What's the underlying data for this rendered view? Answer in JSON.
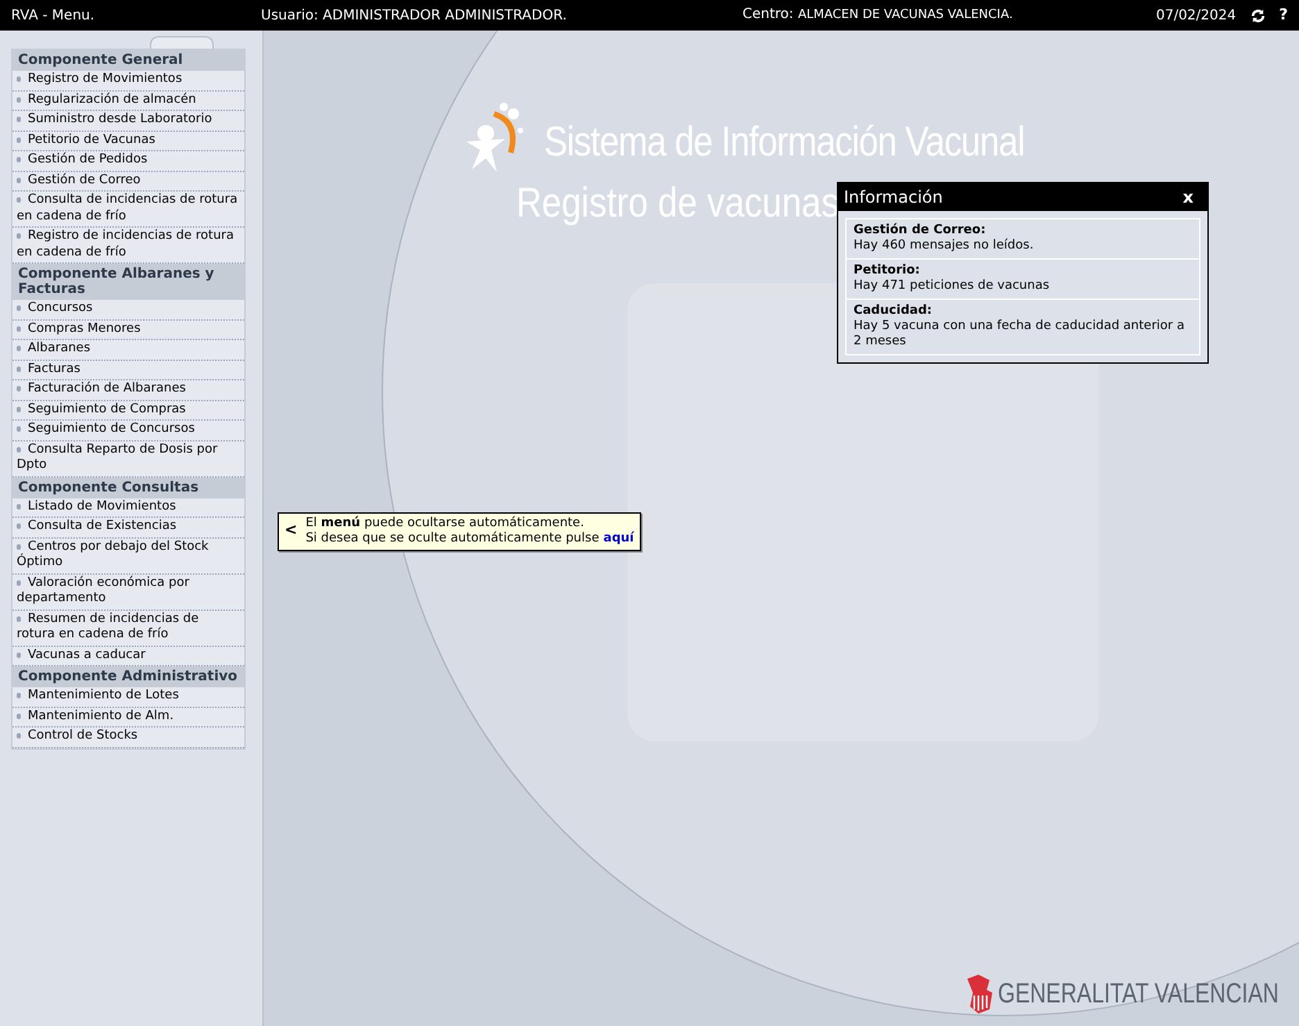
{
  "top_bar": {
    "app": "RVA - Menu.",
    "user_label": "Usuario:",
    "user": "ADMINISTRADOR ADMINISTRADOR.",
    "center_label": "Centro:",
    "center": "ALMACEN DE VACUNAS VALENCIA.",
    "date": "07/02/2024",
    "help": "?"
  },
  "menu": [
    {
      "title": "Componente General",
      "items": [
        "Registro de Movimientos",
        "Regularización de almacén",
        "Suministro desde Laboratorio",
        "Petitorio de Vacunas",
        "Gestión de Pedidos",
        "Gestión de Correo",
        "Consulta de incidencias de rotura en cadena de frío",
        "Registro de incidencias de rotura en cadena de frío"
      ]
    },
    {
      "title": "Componente Albaranes y Facturas",
      "items": [
        "Concursos",
        "Compras Menores",
        "Albaranes",
        "Facturas",
        "Facturación de Albaranes",
        "Seguimiento de Compras",
        "Seguimiento de Concursos",
        "Consulta Reparto de Dosis por Dpto"
      ]
    },
    {
      "title": "Componente Consultas",
      "items": [
        "Listado de Movimientos",
        "Consulta de Existencias",
        "Centros por debajo del Stock Óptimo",
        "Valoración económica por departamento",
        "Resumen de incidencias de rotura en cadena de frío",
        "Vacunas a caducar"
      ]
    },
    {
      "title": "Componente Administrativo",
      "items": [
        "Mantenimiento de Lotes",
        "Mantenimiento de Alm.",
        "Control de Stocks"
      ]
    }
  ],
  "tooltip": {
    "arrow": "<",
    "line_1": "El **menú** puede ocultarse automáticamente.",
    "line_2": "Si desea que se oculte automáticamente pulse",
    "link": "aquí"
  },
  "banner": {
    "title": "Sistema de Información Vacunal",
    "subtitle": "Registro de vacunas"
  },
  "info_dialog": {
    "title": "Información",
    "close": "x",
    "sections": [
      {
        "heading": "Gestión de Correo:",
        "text": "Hay 460 mensajes no leídos."
      },
      {
        "heading": "Petitorio:",
        "text": "Hay 471 peticiones de vacunas"
      },
      {
        "heading": "Caducidad:",
        "text": "Hay 5 vacuna con una fecha de caducidad anterior a 2 meses"
      }
    ]
  },
  "footer_logo": "GENERALITAT VALENCIAN"
}
